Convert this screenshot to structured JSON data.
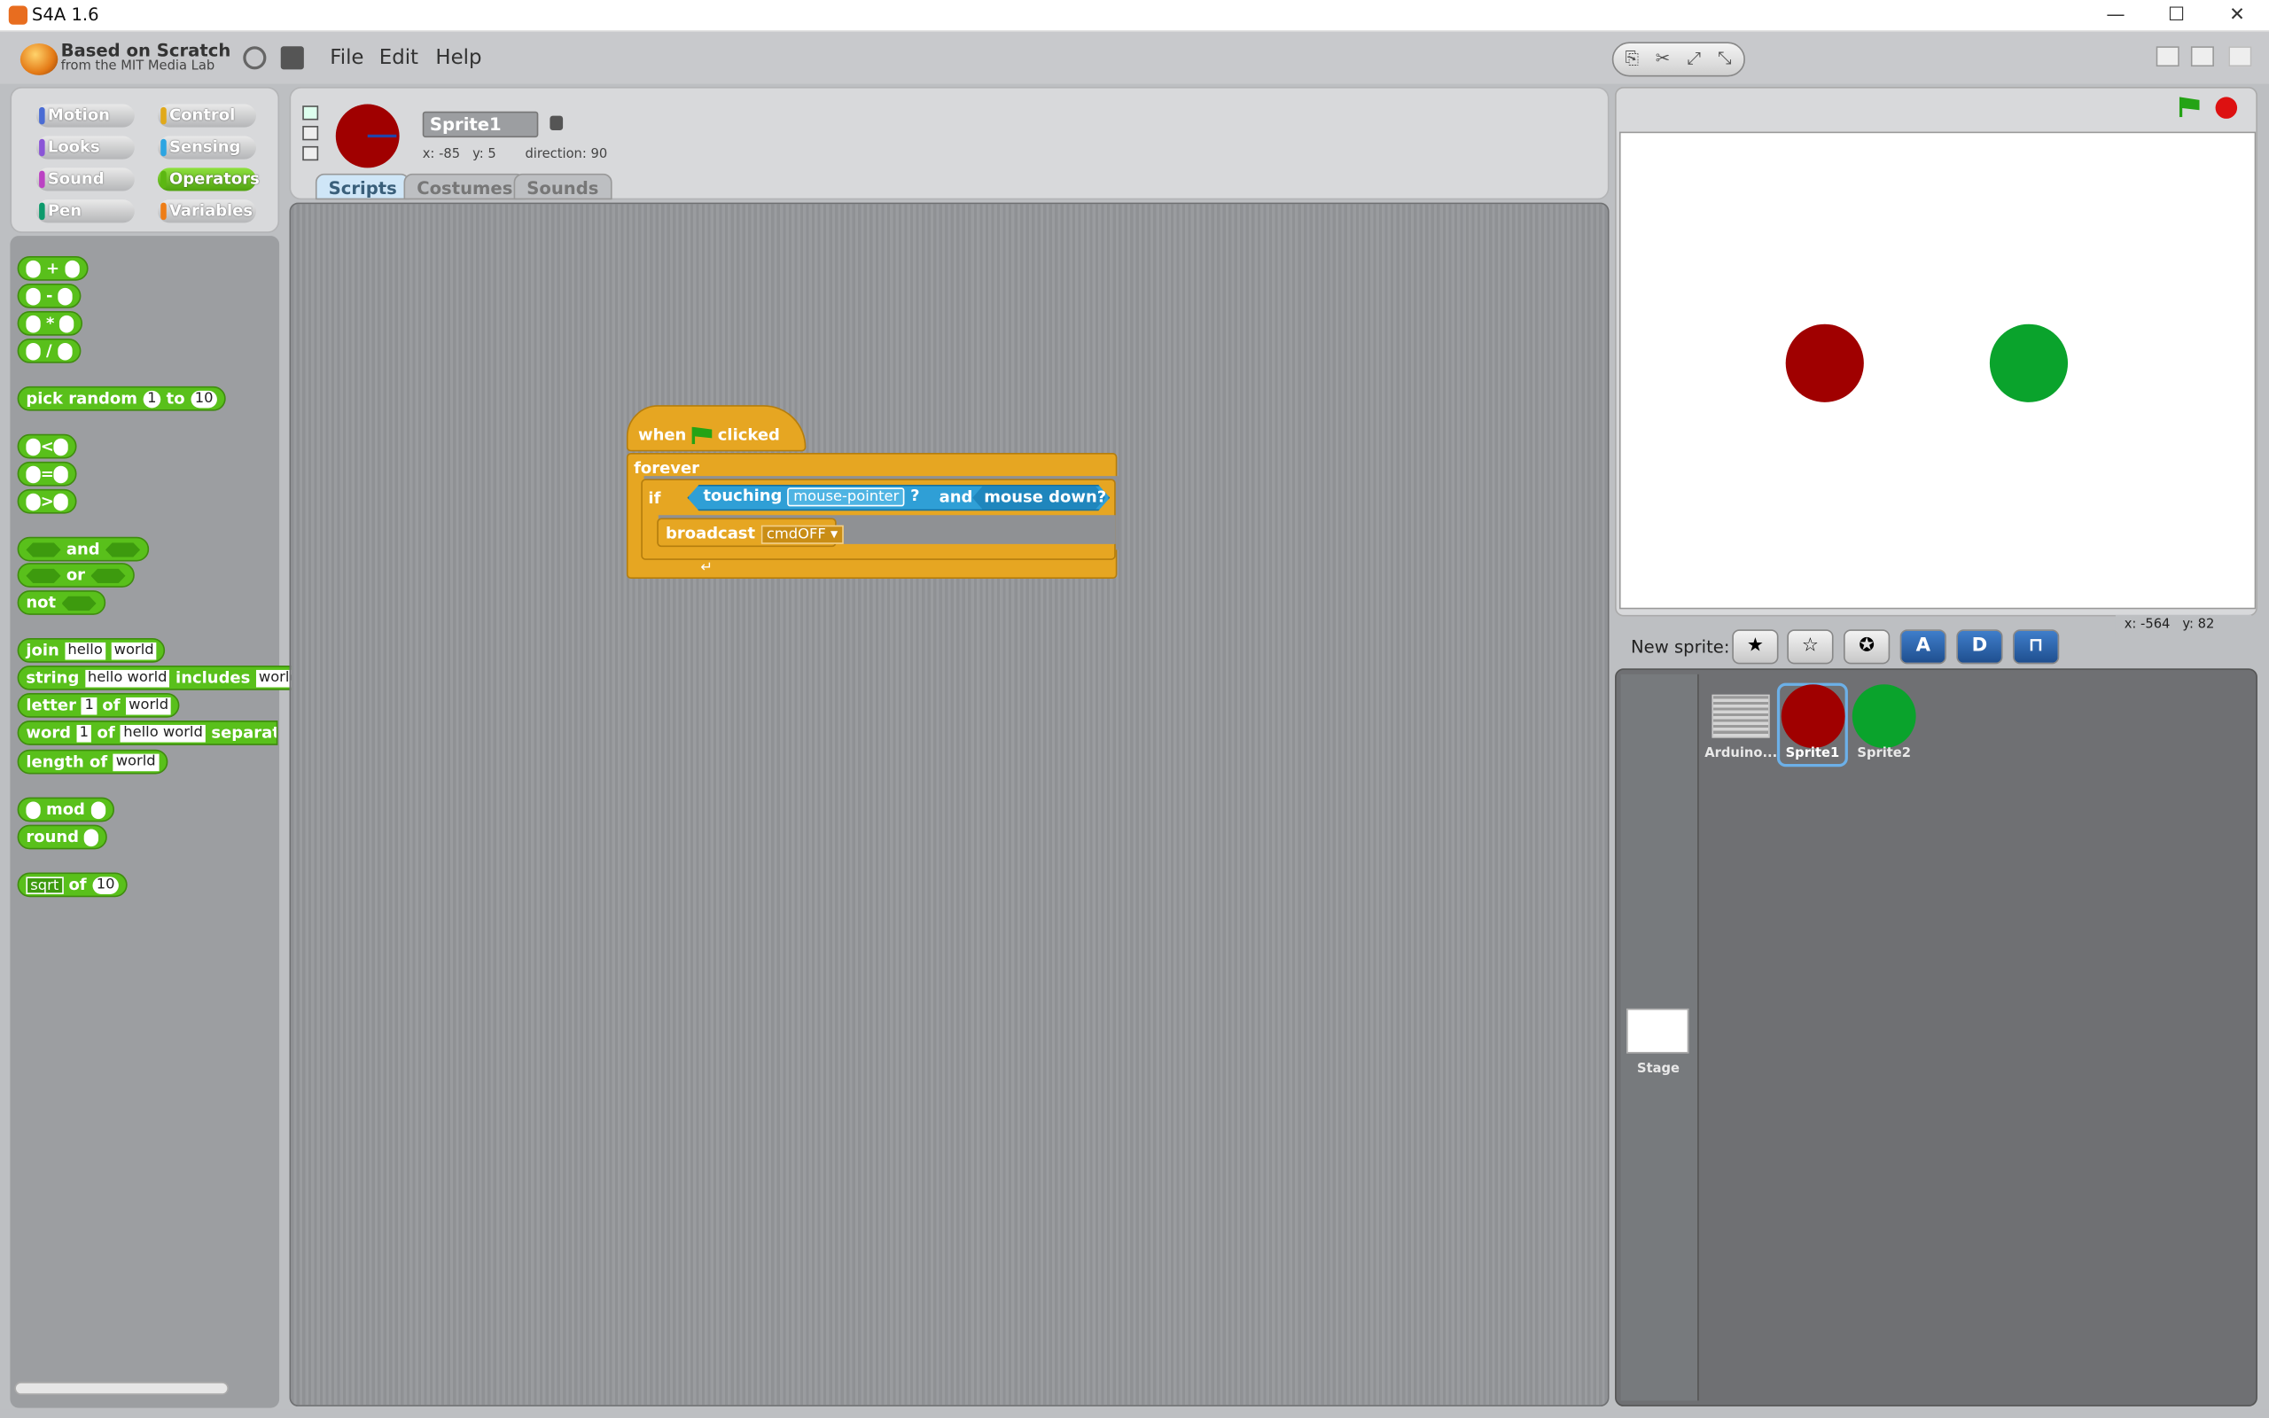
{
  "window": {
    "title": "S4A 1.6",
    "minimize": "—",
    "maximize": "☐",
    "close": "✕"
  },
  "menubar": {
    "logo_line1": "Based on Scratch",
    "logo_line2": "from the MIT Media Lab",
    "menus": [
      "File",
      "Edit",
      "Help"
    ]
  },
  "categories": [
    {
      "label": "Motion",
      "color": "#4a6cd4"
    },
    {
      "label": "Control",
      "color": "#e1a91a"
    },
    {
      "label": "Looks",
      "color": "#8a55d7"
    },
    {
      "label": "Sensing",
      "color": "#2ca5e2"
    },
    {
      "label": "Sound",
      "color": "#bb42c3"
    },
    {
      "label": "Operators",
      "color": "#5cb712"
    },
    {
      "label": "Pen",
      "color": "#0e9a6c"
    },
    {
      "label": "Variables",
      "color": "#ee7d16"
    }
  ],
  "palette": {
    "plus": "+",
    "minus": "-",
    "times": "*",
    "divide": "/",
    "pick_random": "pick random",
    "pick_from": "1",
    "pick_to_word": "to",
    "pick_to": "10",
    "lt": "<",
    "eq": "=",
    "gt": ">",
    "and": "and",
    "or": "or",
    "not": "not",
    "join": "join",
    "join_a": "hello",
    "join_b": "world",
    "string": "string",
    "string_a": "hello world",
    "includes": "includes",
    "string_b": "world",
    "letter": "letter",
    "letter_n": "1",
    "letter_of": "of",
    "letter_word": "world",
    "word": "word",
    "word_n": "1",
    "word_of": "of",
    "word_text": "hello world",
    "separator": "separator",
    "length_of": "length of",
    "length_word": "world",
    "mod": "mod",
    "round": "round",
    "sqrt": "sqrt",
    "sqrt_of": "of",
    "sqrt_val": "10"
  },
  "sprite_info": {
    "name": "Sprite1",
    "x_label": "x:",
    "x": "-85",
    "y_label": "y:",
    "y": "5",
    "direction_label": "direction:",
    "direction": "90"
  },
  "tabs": [
    "Scripts",
    "Costumes",
    "Sounds"
  ],
  "script": {
    "when": "when",
    "clicked": "clicked",
    "forever": "forever",
    "if": "if",
    "touching": "touching",
    "touching_target": "mouse-pointer",
    "question": "?",
    "and": "and",
    "mouse_down": "mouse down?",
    "broadcast": "broadcast",
    "broadcast_msg": "cmdOFF"
  },
  "stage": {
    "coords": "x: -564   y: 82",
    "sprite1_color": "#a00000",
    "sprite2_color": "#0aa32c"
  },
  "new_sprite_label": "New sprite:",
  "sprites": [
    {
      "label": "Arduino..."
    },
    {
      "label": "Sprite1"
    },
    {
      "label": "Sprite2"
    }
  ],
  "stage_label": "Stage"
}
